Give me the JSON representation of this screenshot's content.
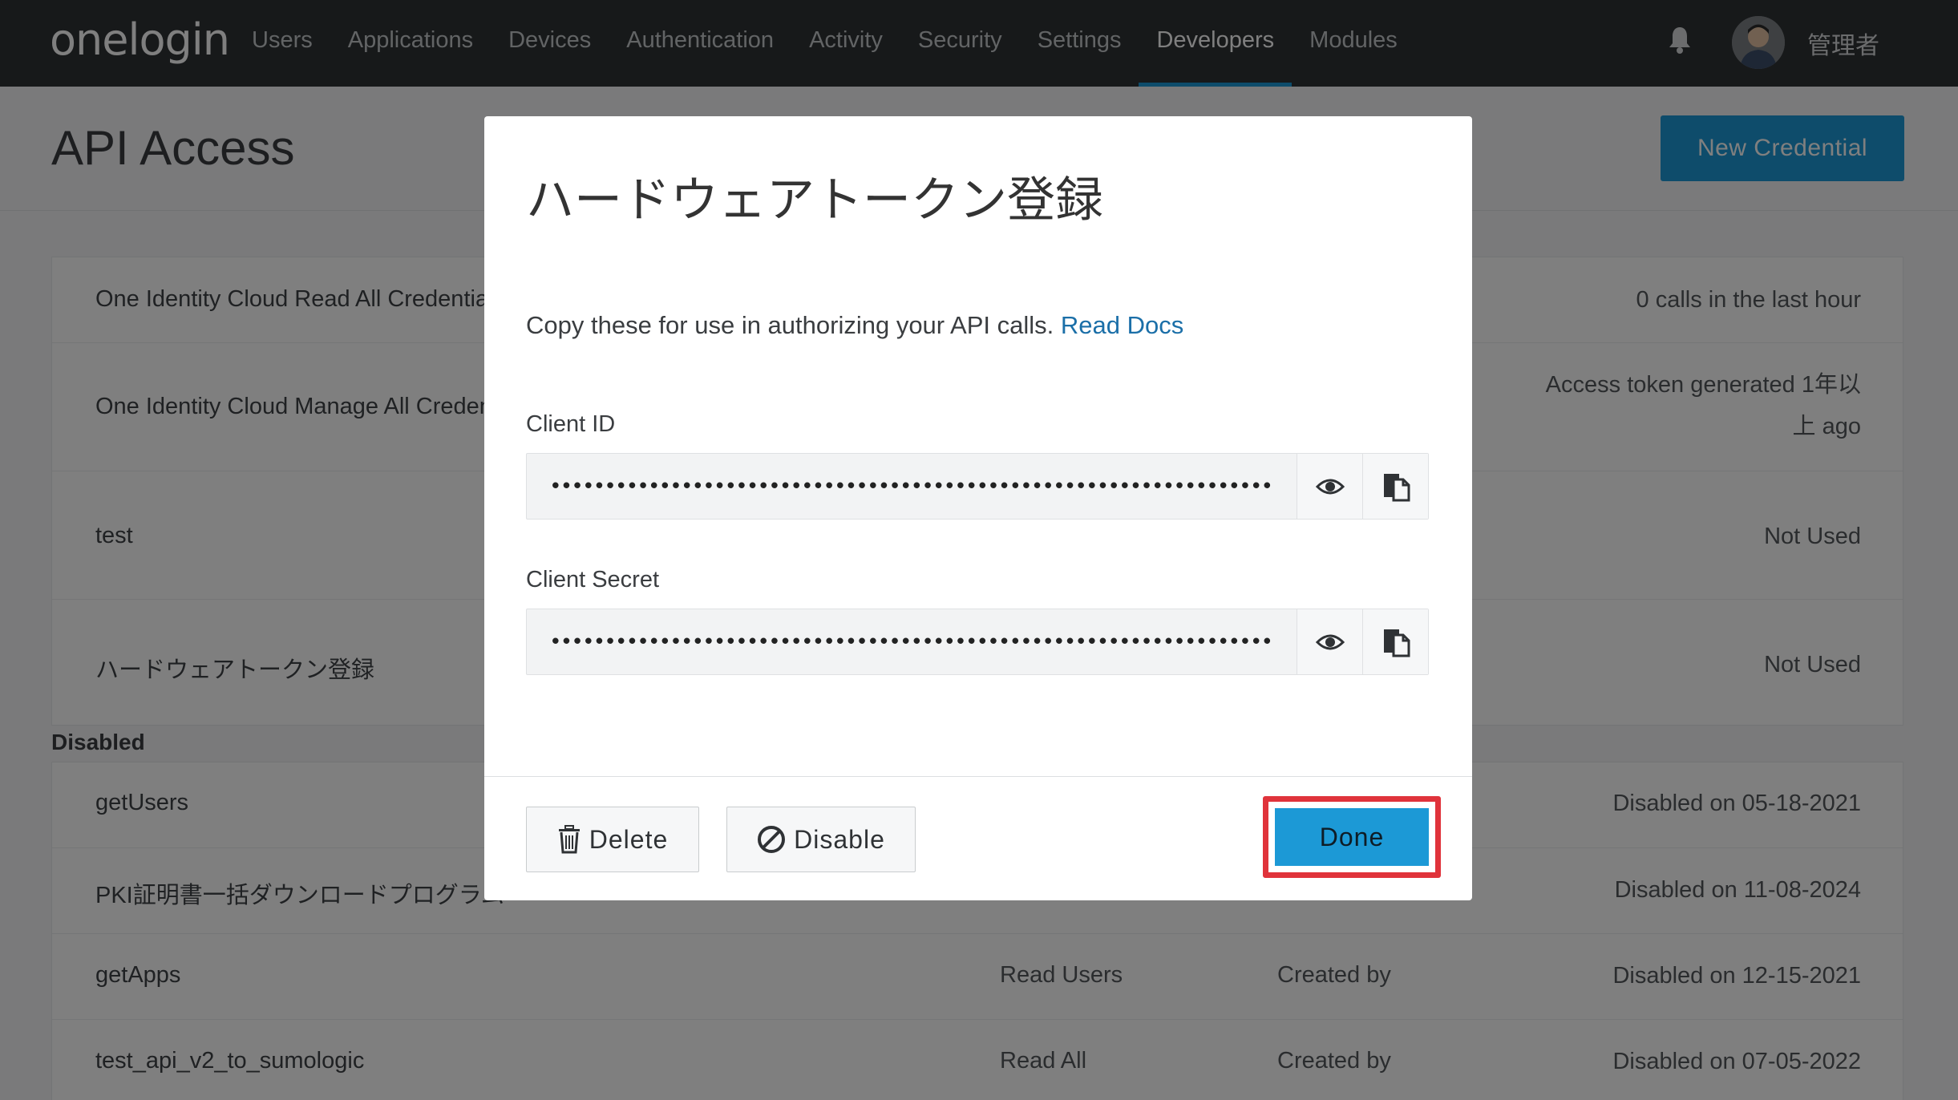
{
  "nav": {
    "logo": "onelogin",
    "items": [
      {
        "label": "Users"
      },
      {
        "label": "Applications"
      },
      {
        "label": "Devices"
      },
      {
        "label": "Authentication"
      },
      {
        "label": "Activity"
      },
      {
        "label": "Security"
      },
      {
        "label": "Settings"
      },
      {
        "label": "Developers",
        "active": true
      },
      {
        "label": "Modules"
      }
    ],
    "bell_icon": "bell-icon",
    "user_name": "管理者"
  },
  "page": {
    "title": "API Access",
    "new_credential_label": "New Credential"
  },
  "enabled_rows": [
    {
      "name": "One Identity Cloud Read All Credentials",
      "status": "0 calls in the last hour"
    },
    {
      "name": "One Identity Cloud Manage All Credentials",
      "status": "Access token generated 1年以上 ago"
    },
    {
      "name": "test",
      "status": "Not Used"
    },
    {
      "name": "ハードウェアトークン登録",
      "status": "Not Used"
    }
  ],
  "disabled_label": "Disabled",
  "disabled_rows": [
    {
      "name": "getUsers",
      "permission": "",
      "creator": "",
      "status": "Disabled on 05-18-2021"
    },
    {
      "name": "PKI証明書一括ダウンロードプログラム",
      "permission": "",
      "creator": "",
      "status": "Disabled on 11-08-2024"
    },
    {
      "name": "getApps",
      "permission": "Read Users",
      "creator": "Created by",
      "status": "Disabled on 12-15-2021"
    },
    {
      "name": "test_api_v2_to_sumologic",
      "permission": "Read All",
      "creator": "Created by",
      "status": "Disabled on 07-05-2022"
    }
  ],
  "modal": {
    "title": "ハードウェアトークン登録",
    "description": "Copy these for use in authorizing your API calls.",
    "read_docs_link": "Read Docs",
    "client_id_label": "Client ID",
    "client_id_value": "•••••••••••••••••••••••••••••••••••••••••••••••••••••••••••••••••••",
    "client_secret_label": "Client Secret",
    "client_secret_value": "•••••••••••••••••••••••••••••••••••••••••••••••••••••••••••••••••••",
    "delete_label": "Delete",
    "disable_label": "Disable",
    "done_label": "Done"
  },
  "colors": {
    "nav_bg": "#2f3235",
    "accent": "#1c99d6",
    "highlight_border": "#e0333b",
    "link": "#1b6fa8"
  }
}
